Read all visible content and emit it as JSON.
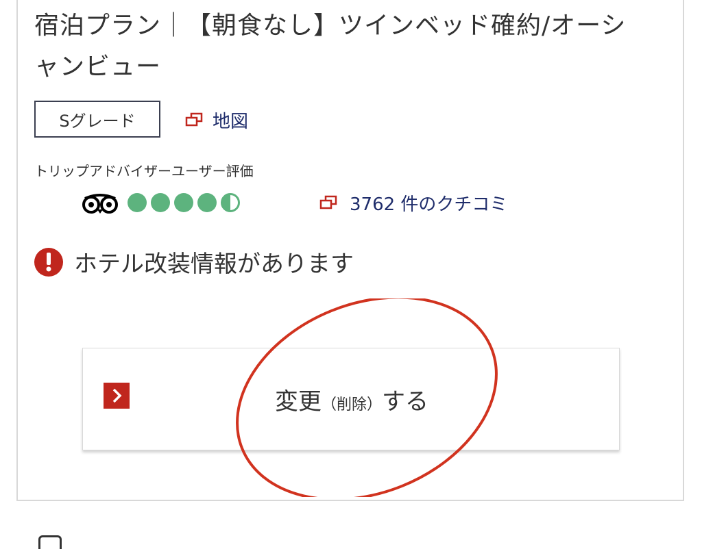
{
  "plan": {
    "title": "宿泊プラン｜【朝食なし】ツインベッド確約/オーシャンビュー"
  },
  "grade": {
    "label": "Sグレード"
  },
  "map": {
    "label": "地図",
    "icon": "external-window-icon"
  },
  "tripadvisor": {
    "label": "トリップアドバイザーユーザー評価",
    "rating": 4.5,
    "max_rating": 5,
    "bubble_color": "#5db37e",
    "reviews_label": "3762 件のクチコミ"
  },
  "notice": {
    "text": "ホテル改装情報があります",
    "icon": "alert-icon",
    "color": "#c0261d"
  },
  "change_button": {
    "label_main": "変更",
    "label_sub": "（削除）",
    "label_end": "する",
    "arrow_icon": "chevron-right-icon"
  },
  "colors": {
    "accent": "#c0261d",
    "link": "#1f2d6b",
    "annotation": "#d1331f"
  }
}
